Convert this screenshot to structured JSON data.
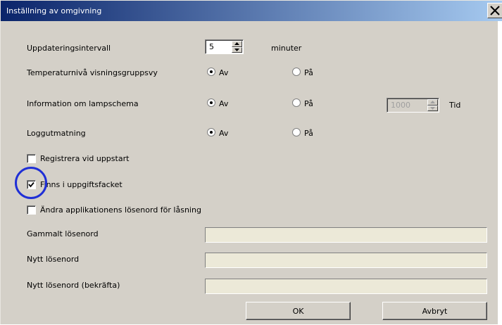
{
  "window": {
    "title": "Inställning av omgivning"
  },
  "update_interval": {
    "label": "Uppdateringsintervall",
    "value": "5",
    "unit": "minuter"
  },
  "temperature_level": {
    "label": "Temperaturnivå visningsgruppsvy",
    "option_off": "Av",
    "option_on": "På",
    "selected": "Av"
  },
  "lamp_schedule": {
    "label": "Information om lampschema",
    "option_off": "Av",
    "option_on": "På",
    "selected": "Av",
    "hours_value": "1000",
    "hours_unit": "Tid"
  },
  "log_output": {
    "label": "Loggutmatning",
    "option_off": "Av",
    "option_on": "På",
    "selected": "Av"
  },
  "register_at_startup": {
    "label": "Registrera vid uppstart",
    "checked": false
  },
  "in_tray": {
    "label": "Finns i uppgiftsfacket",
    "checked": true
  },
  "change_lock_password": {
    "label": "Ändra applikationens lösenord för låsning",
    "checked": false
  },
  "password_fields": {
    "old_label": "Gammalt lösenord",
    "new_label": "Nytt lösenord",
    "confirm_label": "Nytt lösenord (bekräfta)"
  },
  "buttons": {
    "ok": "OK",
    "cancel": "Avbryt"
  },
  "colors": {
    "title_bar": "#0a246a",
    "dialog_bg": "#d4d0c8",
    "highlight_circle": "#1f2fd6"
  }
}
